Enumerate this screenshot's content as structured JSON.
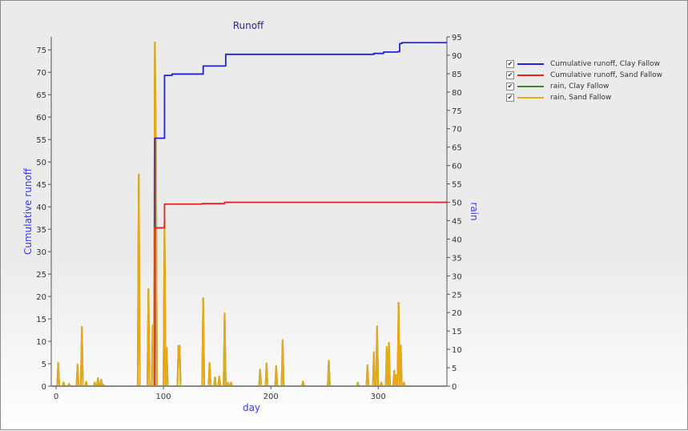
{
  "chart_data": {
    "type": "line",
    "title": "Runoff",
    "xlabel": "day",
    "ylabel_left": "Cumulative runoff",
    "ylabel_right": "rain",
    "xlim": [
      -4.5,
      364
    ],
    "ylim_left": [
      0,
      77.9
    ],
    "ylim_right": [
      0,
      95
    ],
    "x_ticks": [
      0,
      100,
      200,
      300
    ],
    "y_ticks_left": [
      0,
      5,
      10,
      15,
      20,
      25,
      30,
      35,
      40,
      45,
      50,
      55,
      60,
      65,
      70,
      75
    ],
    "y_ticks_right": [
      0,
      5,
      10,
      15,
      20,
      25,
      30,
      35,
      40,
      45,
      50,
      55,
      60,
      65,
      70,
      75,
      80,
      85,
      90,
      95
    ],
    "grid": false,
    "legend_position": "right",
    "series": [
      {
        "name": "Cumulative runoff, Clay Fallow",
        "axis": "left",
        "color": "#2020e0",
        "step": true,
        "x": [
          0,
          91,
          92,
          100,
          101,
          108,
          136,
          137,
          157,
          158,
          296,
          305,
          318,
          320,
          322,
          364
        ],
        "y": [
          0,
          0,
          55.3,
          55.3,
          69.3,
          69.6,
          69.6,
          71.4,
          71.4,
          74.0,
          74.2,
          74.5,
          74.6,
          76.4,
          76.6,
          76.6
        ]
      },
      {
        "name": "Cumulative runoff, Sand Fallow",
        "axis": "left",
        "color": "#e82020",
        "step": true,
        "x": [
          0,
          91,
          92,
          100,
          101,
          136,
          157,
          364
        ],
        "y": [
          0,
          0,
          35.3,
          35.3,
          40.6,
          40.7,
          41.0,
          41.0
        ]
      },
      {
        "name": "rain, Clay Fallow",
        "axis": "right",
        "color": "#2e8b2e",
        "points": [
          [
            2,
            6.3
          ],
          [
            7,
            1
          ],
          [
            12,
            0.6
          ],
          [
            20,
            5.9
          ],
          [
            24,
            16.1
          ],
          [
            28,
            1.2
          ],
          [
            36,
            1
          ],
          [
            39,
            2.2
          ],
          [
            42,
            1.8
          ],
          [
            44,
            0.4
          ],
          [
            77,
            57.6
          ],
          [
            86,
            26.4
          ],
          [
            90,
            16.6
          ],
          [
            92,
            93.5
          ],
          [
            93,
            65
          ],
          [
            101,
            45
          ],
          [
            103,
            10.4
          ],
          [
            114,
            11
          ],
          [
            115,
            11
          ],
          [
            137,
            23.9
          ],
          [
            143,
            6.3
          ],
          [
            148,
            2.4
          ],
          [
            152,
            2.6
          ],
          [
            157,
            19.8
          ],
          [
            160,
            1
          ],
          [
            163,
            1
          ],
          [
            190,
            4.5
          ],
          [
            196,
            6.2
          ],
          [
            205,
            5.5
          ],
          [
            211,
            12.5
          ],
          [
            230,
            1.3
          ],
          [
            254,
            7
          ],
          [
            281,
            1
          ],
          [
            290,
            5.7
          ],
          [
            296,
            9.2
          ],
          [
            299,
            16.3
          ],
          [
            303,
            1
          ],
          [
            308,
            10.7
          ],
          [
            310,
            11.8
          ],
          [
            315,
            4.2
          ],
          [
            317,
            3
          ],
          [
            319,
            22.7
          ],
          [
            321,
            11
          ],
          [
            324,
            1
          ]
        ]
      },
      {
        "name": "rain, Sand Fallow",
        "axis": "right",
        "color": "#e8a818",
        "points": [
          [
            2,
            6.3
          ],
          [
            7,
            1
          ],
          [
            12,
            0.6
          ],
          [
            20,
            5.9
          ],
          [
            24,
            16.1
          ],
          [
            28,
            1.2
          ],
          [
            36,
            1
          ],
          [
            39,
            2.2
          ],
          [
            42,
            1.8
          ],
          [
            44,
            0.4
          ],
          [
            77,
            57.6
          ],
          [
            86,
            26.4
          ],
          [
            90,
            16.6
          ],
          [
            92,
            93.5
          ],
          [
            93,
            65
          ],
          [
            101,
            45
          ],
          [
            103,
            10.4
          ],
          [
            114,
            11
          ],
          [
            115,
            11
          ],
          [
            137,
            23.9
          ],
          [
            143,
            6.3
          ],
          [
            148,
            2.4
          ],
          [
            152,
            2.6
          ],
          [
            157,
            19.8
          ],
          [
            160,
            1
          ],
          [
            163,
            1
          ],
          [
            190,
            4.5
          ],
          [
            196,
            6.2
          ],
          [
            205,
            5.5
          ],
          [
            211,
            12.5
          ],
          [
            230,
            1.3
          ],
          [
            254,
            7
          ],
          [
            281,
            1
          ],
          [
            290,
            5.7
          ],
          [
            296,
            9.2
          ],
          [
            299,
            16.3
          ],
          [
            303,
            1
          ],
          [
            308,
            10.7
          ],
          [
            310,
            11.8
          ],
          [
            315,
            4.2
          ],
          [
            317,
            3
          ],
          [
            319,
            22.7
          ],
          [
            321,
            11
          ],
          [
            324,
            1
          ]
        ]
      }
    ]
  },
  "legend": {
    "items": [
      {
        "label": "Cumulative runoff, Clay Fallow",
        "checked": true,
        "color": "#2020e0"
      },
      {
        "label": "Cumulative runoff, Sand Fallow",
        "checked": true,
        "color": "#e82020"
      },
      {
        "label": "rain, Clay Fallow",
        "checked": true,
        "color": "#2e8b2e"
      },
      {
        "label": "rain, Sand Fallow",
        "checked": true,
        "color": "#e8a818"
      }
    ],
    "check_glyph": "✔"
  }
}
